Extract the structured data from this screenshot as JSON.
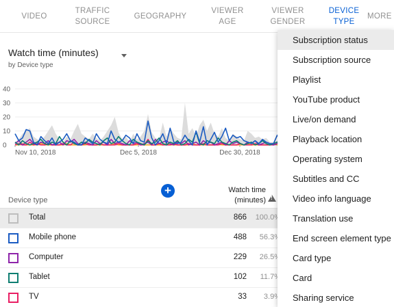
{
  "tabs": [
    {
      "label_lines": [
        "VIDEO"
      ],
      "active": false
    },
    {
      "label_lines": [
        "TRAFFIC",
        "SOURCE"
      ],
      "active": false
    },
    {
      "label_lines": [
        "GEOGRAPHY"
      ],
      "active": false
    },
    {
      "label_lines": [
        "VIEWER",
        "AGE"
      ],
      "active": false
    },
    {
      "label_lines": [
        "VIEWER",
        "GENDER"
      ],
      "active": false
    },
    {
      "label_lines": [
        "DEVICE",
        "TYPE"
      ],
      "active": true
    },
    {
      "label_lines": [
        "MORE"
      ],
      "active": false
    }
  ],
  "metric": {
    "title": "Watch time (minutes)",
    "subtitle": "by Device type"
  },
  "chart_data": {
    "type": "line",
    "yticks": [
      0,
      10,
      20,
      30,
      40
    ],
    "ylim": [
      0,
      40
    ],
    "xticks": [
      "Nov 10, 2018",
      "Dec 5, 2018",
      "Dec 30, 2018"
    ],
    "total_area": [
      2,
      4,
      8,
      10,
      12,
      6,
      4,
      3,
      6,
      10,
      14,
      8,
      4,
      2,
      6,
      4,
      10,
      15,
      8,
      6,
      4,
      8,
      5,
      3,
      6,
      10,
      14,
      20,
      9,
      4,
      6,
      2,
      8,
      4,
      6,
      10,
      22,
      9,
      5,
      4,
      16,
      6,
      12,
      8,
      5,
      4,
      30,
      8,
      12,
      6,
      14,
      18,
      10,
      16,
      8,
      6,
      12,
      5,
      3,
      8,
      6,
      4,
      3,
      10,
      8,
      5,
      6,
      4,
      5,
      2,
      2,
      3,
      9
    ],
    "series": [
      {
        "color": "#1a5bc2",
        "values": [
          8,
          3,
          5,
          11,
          10,
          2,
          0,
          6,
          3,
          1,
          5,
          0,
          2,
          4,
          8,
          3,
          2,
          0,
          0,
          5,
          3,
          1,
          8,
          4,
          2,
          1,
          10,
          4,
          2,
          3,
          7,
          5,
          1,
          8,
          3,
          2,
          17,
          5,
          0,
          3,
          8,
          1,
          12,
          2,
          1,
          2,
          7,
          3,
          0,
          10,
          2,
          13,
          0,
          4,
          9,
          2,
          6,
          12,
          3,
          7,
          5,
          6,
          3,
          2,
          1,
          3,
          1,
          4,
          2,
          1,
          1,
          7,
          2
        ]
      },
      {
        "color": "#0e7e71",
        "values": [
          2,
          0,
          3,
          1,
          0,
          1,
          2,
          4,
          1,
          0,
          2,
          1,
          6,
          2,
          0,
          3,
          1,
          0,
          2,
          1,
          4,
          2,
          1,
          0,
          3,
          5,
          1,
          2,
          6,
          3,
          1,
          0,
          4,
          2,
          1,
          0,
          3,
          1,
          2,
          5,
          1,
          0,
          2,
          1,
          3,
          0,
          1,
          4,
          2,
          9,
          1,
          0,
          3,
          2,
          1,
          5,
          2,
          1,
          0,
          2,
          3,
          1,
          0,
          1,
          2,
          0,
          1,
          3,
          1,
          0,
          1,
          2,
          0
        ]
      },
      {
        "color": "#8e24aa",
        "values": [
          1,
          3,
          0,
          2,
          4,
          1,
          0,
          2,
          1,
          3,
          0,
          1,
          2,
          0,
          3,
          2,
          4,
          1,
          0,
          2,
          1,
          0,
          3,
          1,
          2,
          0,
          4,
          1,
          2,
          1,
          0,
          3,
          1,
          2,
          0,
          1,
          2,
          0,
          4,
          1,
          2,
          3,
          1,
          0,
          2,
          1,
          3,
          0,
          1,
          2,
          0,
          3,
          1,
          2,
          0,
          1,
          2,
          0,
          3,
          1,
          2,
          1,
          0,
          2,
          1,
          3,
          0,
          1,
          2,
          1,
          0,
          1,
          2
        ]
      },
      {
        "color": "#e91e63",
        "values": [
          0,
          1,
          0,
          0,
          2,
          0,
          1,
          0,
          0,
          1,
          0,
          0,
          0,
          1,
          0,
          0,
          2,
          0,
          0,
          1,
          0,
          0,
          0,
          1,
          0,
          0,
          0,
          0,
          1,
          0,
          0,
          0,
          0,
          1,
          0,
          0,
          4,
          0,
          0,
          1,
          0,
          0,
          0,
          1,
          0,
          0,
          0,
          1,
          0,
          0,
          0,
          1,
          0,
          0,
          0,
          0,
          1,
          0,
          0,
          0,
          0,
          1,
          0,
          0,
          0,
          1,
          0,
          0,
          0,
          0,
          0,
          1,
          0
        ]
      },
      {
        "color": "#f9a825",
        "values": [
          0,
          0,
          1,
          0,
          0,
          0,
          0,
          1,
          0,
          0,
          0,
          0,
          0,
          0,
          1,
          0,
          0,
          0,
          0,
          0,
          1,
          0,
          0,
          0,
          0,
          0,
          0,
          1,
          0,
          0,
          0,
          0,
          0,
          0,
          1,
          0,
          0,
          0,
          0,
          0,
          0,
          1,
          0,
          0,
          0,
          0,
          0,
          0,
          1,
          0,
          0,
          0,
          0,
          0,
          0,
          1,
          0,
          0,
          0,
          0,
          0,
          0,
          0,
          1,
          0,
          0,
          0,
          0,
          0,
          0,
          1,
          0,
          0
        ]
      }
    ]
  },
  "table": {
    "col_name": "Device type",
    "col_metric_line1": "Watch time",
    "col_metric_line2": "(minutes)",
    "rows": [
      {
        "label": "Total",
        "value": "866",
        "pct": "100.0%",
        "color": "#9e9e9e",
        "total": true
      },
      {
        "label": "Mobile phone",
        "value": "488",
        "pct": "56.3%",
        "color": "#1a5bc2",
        "total": false
      },
      {
        "label": "Computer",
        "value": "229",
        "pct": "26.5%",
        "color": "#8e24aa",
        "total": false
      },
      {
        "label": "Tablet",
        "value": "102",
        "pct": "11.7%",
        "color": "#0e7e71",
        "total": false
      },
      {
        "label": "TV",
        "value": "33",
        "pct": "3.9%",
        "color": "#e91e63",
        "total": false
      }
    ]
  },
  "menu": {
    "items": [
      "Subscription status",
      "Subscription source",
      "Playlist",
      "YouTube product",
      "Live/on demand",
      "Playback location",
      "Operating system",
      "Subtitles and CC",
      "Video info language",
      "Translation use",
      "End screen element type",
      "Card type",
      "Card",
      "Sharing service"
    ],
    "highlighted_index": 0
  },
  "colors": {
    "accent": "#065fd4",
    "area": "#dcdcdc"
  }
}
